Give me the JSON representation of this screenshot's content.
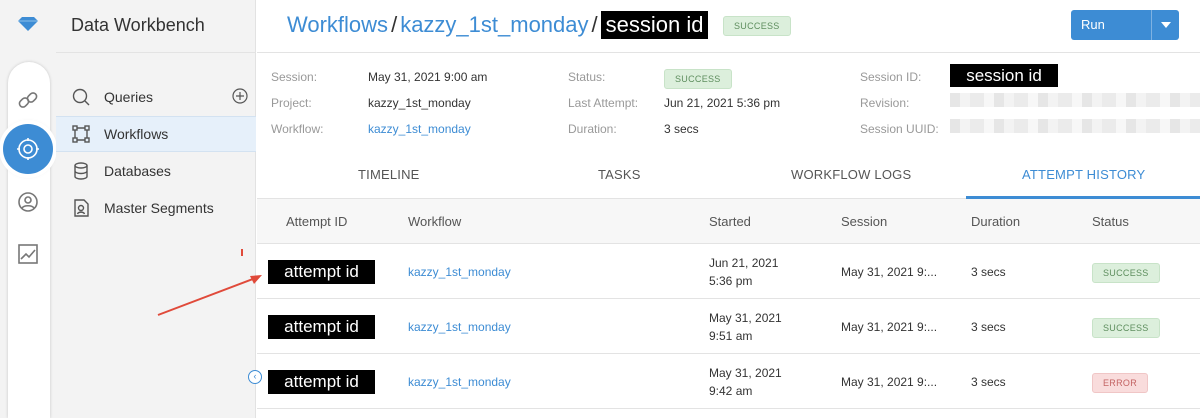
{
  "app": {
    "title": "Data Workbench"
  },
  "nav": {
    "items": [
      {
        "label": "Queries",
        "icon": "queries-icon"
      },
      {
        "label": "Workflows",
        "icon": "workflow-icon"
      },
      {
        "label": "Databases",
        "icon": "database-icon"
      },
      {
        "label": "Master Segments",
        "icon": "segment-icon"
      }
    ]
  },
  "breadcrumb": {
    "root": "Workflows",
    "separator": "/",
    "workflow": "kazzy_1st_monday",
    "session": "session id",
    "status": "SUCCESS"
  },
  "run_button": {
    "label": "Run"
  },
  "details": {
    "col1": [
      {
        "key": "Session:",
        "value": "May 31, 2021 9:00 am"
      },
      {
        "key": "Project:",
        "value": "kazzy_1st_monday"
      },
      {
        "key": "Workflow:",
        "value": "kazzy_1st_monday"
      }
    ],
    "col2": [
      {
        "key": "Status:",
        "value": "SUCCESS"
      },
      {
        "key": "Last Attempt:",
        "value": "Jun 21, 2021 5:36 pm"
      },
      {
        "key": "Duration:",
        "value": "3 secs"
      }
    ],
    "col3": [
      {
        "key": "Session ID:",
        "value": "session id"
      },
      {
        "key": "Revision:",
        "value": ""
      },
      {
        "key": "Session UUID:",
        "value": ""
      }
    ]
  },
  "tabs": [
    "TIMELINE",
    "TASKS",
    "WORKFLOW LOGS",
    "ATTEMPT HISTORY"
  ],
  "table": {
    "headers": [
      "Attempt ID",
      "Workflow",
      "Started",
      "Session",
      "Duration",
      "Status"
    ],
    "rows": [
      {
        "attempt": "attempt id",
        "workflow": "kazzy_1st_monday",
        "started_date": "Jun 21, 2021",
        "started_time": "5:36 pm",
        "session": "May 31, 2021 9:...",
        "duration": "3 secs",
        "status": "SUCCESS"
      },
      {
        "attempt": "attempt id",
        "workflow": "kazzy_1st_monday",
        "started_date": "May 31, 2021",
        "started_time": "9:51 am",
        "session": "May 31, 2021 9:...",
        "duration": "3 secs",
        "status": "SUCCESS"
      },
      {
        "attempt": "attempt id",
        "workflow": "kazzy_1st_monday",
        "started_date": "May 31, 2021",
        "started_time": "9:42 am",
        "session": "May 31, 2021 9:...",
        "duration": "3 secs",
        "status": "ERROR"
      }
    ]
  },
  "colors": {
    "accent": "#3d8cd4",
    "success_bg": "#dcefdc",
    "error_bg": "#f9dcdc",
    "annotation": "#e04a3a"
  }
}
